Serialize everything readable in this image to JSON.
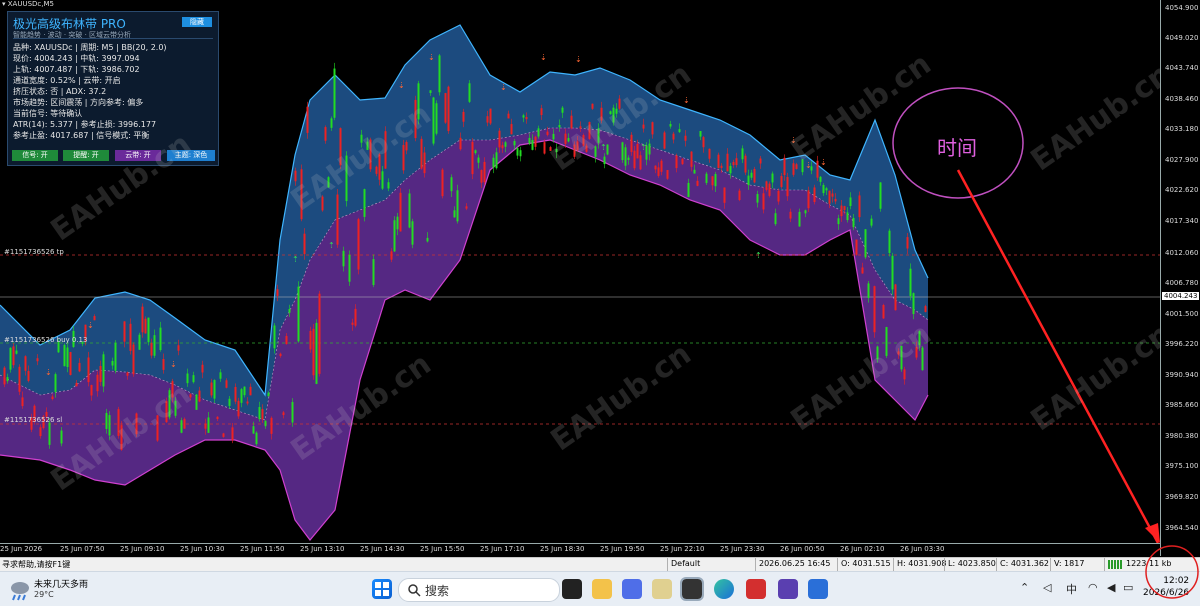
{
  "chart": {
    "symbol_tab": "XAUUSDc,M5",
    "price_labels": [
      "4054.900",
      "4049.020",
      "4043.740",
      "4038.460",
      "4033.180",
      "4027.900",
      "4022.620",
      "4017.340",
      "4012.060",
      "4006.780",
      "4001.500",
      "3996.220",
      "3990.940",
      "3985.660",
      "3980.380",
      "3975.100",
      "3969.820",
      "3964.540"
    ],
    "current_price": "4004.243",
    "time_labels": [
      "25 Jun 2026",
      "25 Jun 07:50",
      "25 Jun 09:10",
      "25 Jun 10:30",
      "25 Jun 11:50",
      "25 Jun 13:10",
      "25 Jun 14:30",
      "25 Jun 15:50",
      "25 Jun 17:10",
      "25 Jun 18:30",
      "25 Jun 19:50",
      "25 Jun 22:10",
      "25 Jun 23:30",
      "26 Jun 00:50",
      "26 Jun 02:10",
      "26 Jun 03:30"
    ],
    "order_labels": {
      "tp": "#1151736526 tp",
      "buy": "#1151736526 buy 0.13",
      "sl": "#1151736526 sl"
    },
    "watermark": "EAHub.cn",
    "annotation": "时间",
    "colors": {
      "upper_band": "#1d4f86",
      "lower_band": "#5a2a8a",
      "bull": "#22dd22",
      "bear": "#ee2222",
      "annotation": "#e060e0",
      "arrow": "#ff2222"
    }
  },
  "panel": {
    "title": "极光高级布林带 PRO",
    "subtitle": "智能趋势 · 波动 · 突破 · 区域云带分析",
    "hide_button": "隐藏",
    "lines": [
      "品种: XAUUSDc  |  周期: M5  |  BB(20, 2.0)",
      "现价: 4004.243  |  中轨: 3997.094",
      "上轨: 4007.487  |  下轨: 3986.702",
      "通道宽度: 0.52%  |  云带: 开启",
      "挤压状态: 否  |  ADX: 37.2",
      "市场趋势: 区间震荡  |  方向参考: 偏多",
      "当前信号: 等待确认",
      "ATR(14): 5.377  |  参考止损: 3996.177",
      "参考止盈: 4017.687  |  信号模式: 平衡"
    ],
    "buttons": [
      {
        "label": "信号: 开",
        "color": "#1f8a3a"
      },
      {
        "label": "提醒: 开",
        "color": "#1f8a3a"
      },
      {
        "label": "云带: 开",
        "color": "#6a2a9a"
      },
      {
        "label": "主题: 深色",
        "color": "#1e7fd0"
      }
    ]
  },
  "status_bar": {
    "help": "寻求帮助,请按F1键",
    "profile": "Default",
    "datetime": "2026.06.25 16:45",
    "open": "O: 4031.515",
    "high": "H: 4031.908",
    "low": "L: 4023.850",
    "close": "C: 4031.362",
    "volume": "V: 1817",
    "traffic": "1223/11 kb"
  },
  "taskbar": {
    "weather_text": "未来几天多雨",
    "temperature": "29°C",
    "search_placeholder": "搜索",
    "ime": "中",
    "time": "12:02",
    "date": "2026/6/26"
  }
}
